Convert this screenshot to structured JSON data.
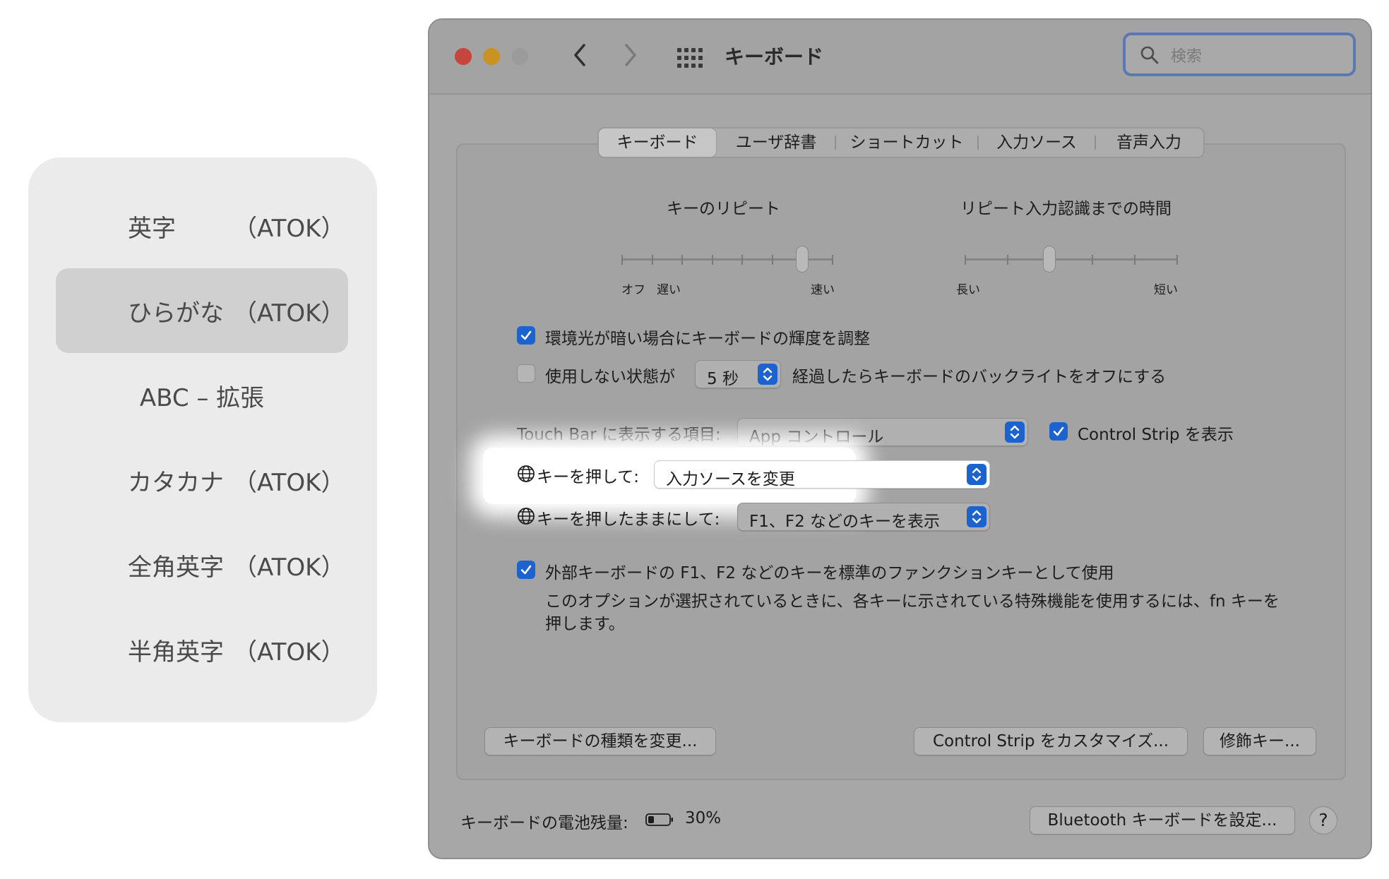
{
  "ime_popup": {
    "items": [
      {
        "label": "英字",
        "suffix": "（ATOK）",
        "selected": false
      },
      {
        "label": "ひらがな",
        "suffix": "（ATOK）",
        "selected": true
      },
      {
        "label": "ABC – 拡張",
        "suffix": "",
        "selected": false
      },
      {
        "label": "カタカナ",
        "suffix": "（ATOK）",
        "selected": false
      },
      {
        "label": "全角英字",
        "suffix": "（ATOK）",
        "selected": false
      },
      {
        "label": "半角英字",
        "suffix": "（ATOK）",
        "selected": false
      }
    ]
  },
  "window": {
    "title": "キーボード",
    "search_placeholder": "検索",
    "tabs": [
      "キーボード",
      "ユーザ辞書",
      "ショートカット",
      "入力ソース",
      "音声入力"
    ],
    "active_tab": 0,
    "key_repeat": {
      "title": "キーのリピート",
      "label_off": "オフ",
      "label_slow": "遅い",
      "label_fast": "速い",
      "tick_count": 8,
      "level": 0.86
    },
    "repeat_delay": {
      "title": "リピート入力認識までの時間",
      "label_long": "長い",
      "label_short": "短い",
      "tick_count": 6,
      "level": 0.4
    },
    "brightness_checkbox": {
      "label": "環境光が暗い場合にキーボードの輝度を調整",
      "checked": true
    },
    "backlight_off": {
      "checked": false,
      "label_before": "使用しない状態が",
      "value": "5 秒",
      "label_after": "経過したらキーボードのバックライトをオフにする"
    },
    "touchbar": {
      "label": "Touch Bar に表示する項目:",
      "value": "App コントロール",
      "control_strip_label": "Control Strip を表示",
      "control_strip_checked": true
    },
    "globe_press": {
      "label": "キーを押して:",
      "value": "入力ソースを変更"
    },
    "globe_hold": {
      "label": "キーを押したままにして:",
      "value": "F1、F2 などのキーを表示"
    },
    "fn_keys": {
      "label": "外部キーボードの F1、F2 などのキーを標準のファンクションキーとして使用",
      "checked": true,
      "description_line1": "このオプションが選択されているときに、各キーに示されている特殊機能を使用するには、fn キーを",
      "description_line2": "押します。"
    },
    "buttons": {
      "change_type": "キーボードの種類を変更...",
      "customize_strip": "Control Strip をカスタマイズ...",
      "modifier_keys": "修飾キー...",
      "bluetooth": "Bluetooth キーボードを設定...",
      "help": "?"
    },
    "battery": {
      "label": "キーボードの電池残量:",
      "percent": "30%",
      "level": 0.3
    }
  }
}
